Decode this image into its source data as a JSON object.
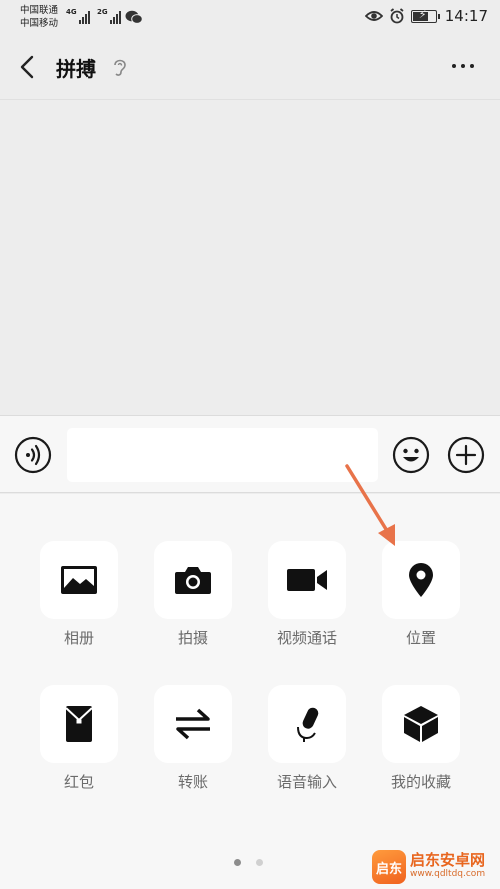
{
  "status_bar": {
    "carrier_1": "中国联通",
    "carrier_2": "中国移动",
    "network_1": "4G",
    "network_2": "2G",
    "time": "14:17"
  },
  "header": {
    "title": "拼搏"
  },
  "input_bar": {
    "placeholder": ""
  },
  "panel": {
    "items": [
      {
        "label": "相册",
        "icon": "photo-album-icon"
      },
      {
        "label": "拍摄",
        "icon": "camera-icon"
      },
      {
        "label": "视频通话",
        "icon": "video-call-icon"
      },
      {
        "label": "位置",
        "icon": "location-pin-icon"
      },
      {
        "label": "红包",
        "icon": "red-packet-icon"
      },
      {
        "label": "转账",
        "icon": "transfer-icon"
      },
      {
        "label": "语音输入",
        "icon": "microphone-icon"
      },
      {
        "label": "我的收藏",
        "icon": "favorites-box-icon"
      }
    ],
    "pages": 2,
    "current_page": 1
  },
  "annotation": {
    "arrow_color": "#e8734a"
  },
  "watermark": {
    "logo_text": "启东",
    "title": "启东安卓网",
    "url": "www.qdltdq.com"
  }
}
